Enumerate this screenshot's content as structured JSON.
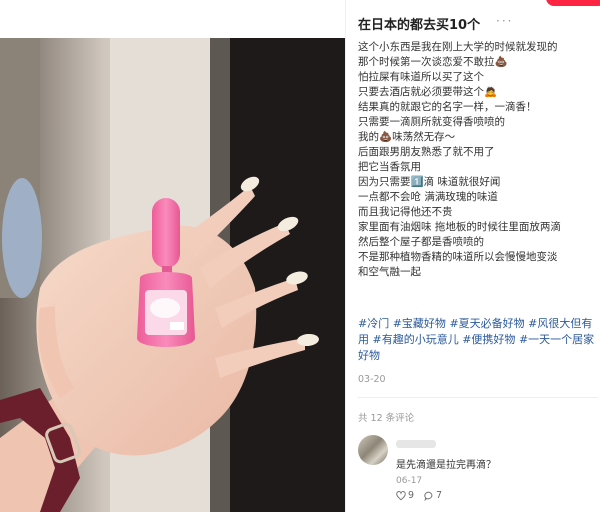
{
  "post": {
    "title": "在日本的都去买10个",
    "body_lines": [
      "这个小东西是我在刚上大学的时候就发现的",
      "那个时候第一次谈恋爱不敢拉💩",
      "怕拉屎有味道所以买了这个",
      "只要去酒店就必须要带这个🙇",
      "结果真的就跟它的名字一样，一滴香！",
      "只需要一滴厕所就变得香喷喷的",
      "我的💩味荡然无存～",
      "后面跟男朋友熟悉了就不用了",
      "把它当香氛用",
      "因为只需要1️⃣滴 味道就很好闻",
      "一点都不会呛 满满玫瑰的味道",
      "而且我记得他还不贵",
      "家里面有油烟味 拖地板的时候往里面放两滴",
      "然后整个屋子都是香喷喷的",
      "不是那种植物香精的味道所以会慢慢地变淡",
      "和空气融一起"
    ],
    "tags": [
      "#冷门",
      "#宝藏好物",
      "#夏天必备好物",
      "#风很大但有用",
      "#有趣的小玩意儿",
      "#便携好物",
      "#一天一个居家好物"
    ],
    "date": "03-20"
  },
  "comments": {
    "count_label": "共 12 条评论",
    "items": [
      {
        "text": "是先滴還是拉完再滴？",
        "date": "06-17",
        "likes": "9",
        "replies": "7"
      }
    ]
  },
  "colors": {
    "accent": "#ff2442",
    "tag": "#2b5a9b",
    "bottle_pink": "#f46fa8"
  }
}
